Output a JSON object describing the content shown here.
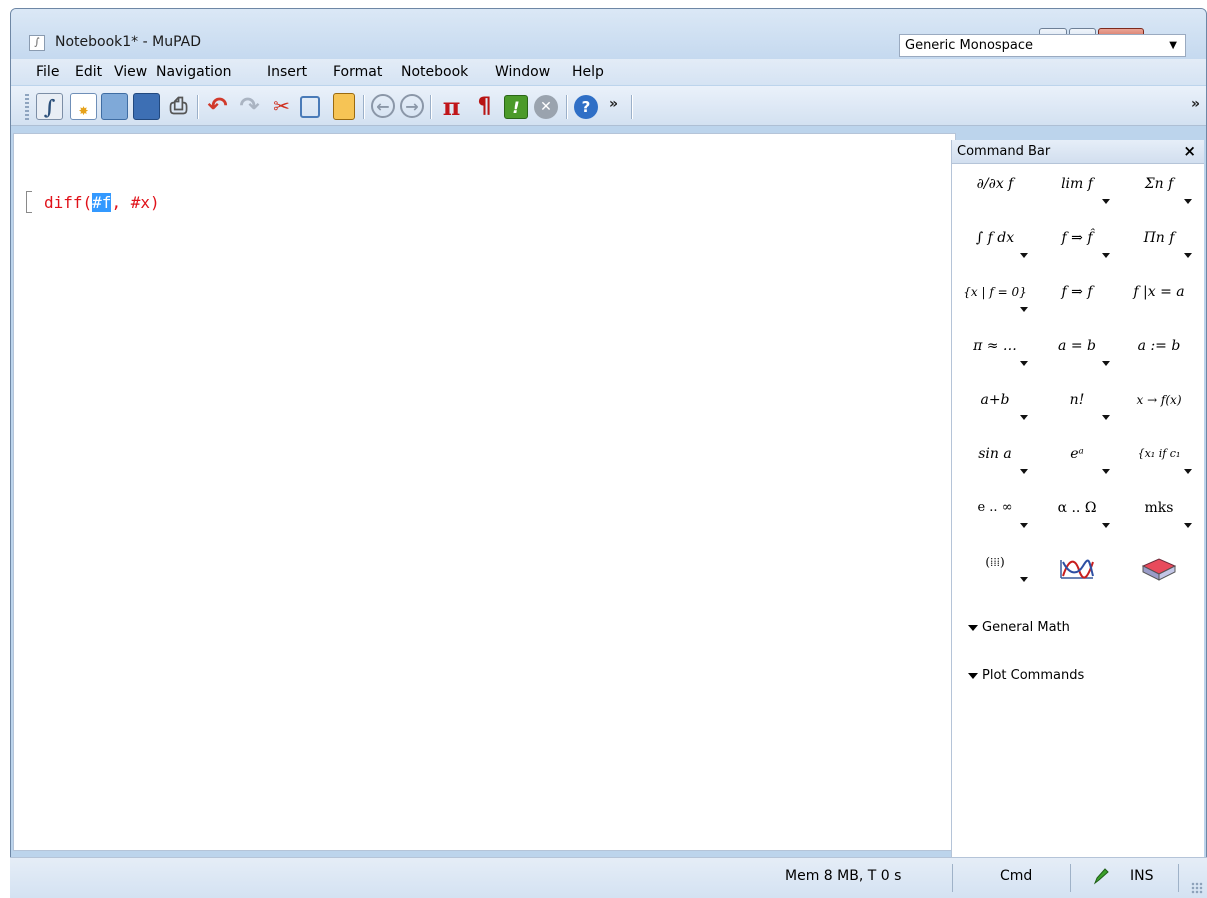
{
  "window": {
    "title": "Notebook1* - MuPAD"
  },
  "menu": [
    "File",
    "Edit",
    "View",
    "Navigation",
    "Insert",
    "Format",
    "Notebook",
    "Window",
    "Help"
  ],
  "toolbar": {
    "buttons": [
      "new-notebook-icon",
      "new-editor-icon",
      "open-icon",
      "save-icon",
      "print-icon",
      "undo-icon",
      "redo-icon",
      "cut-icon",
      "copy-icon",
      "paste-icon",
      "back-icon",
      "forward-icon",
      "insert-calculation-icon",
      "insert-text-icon",
      "evaluate-icon",
      "stop-icon",
      "help-icon"
    ],
    "overflow_label": "»",
    "font_select": "Generic Monospace",
    "overflow2_label": "»"
  },
  "document": {
    "input_prefix": "diff(",
    "input_selected": "#f",
    "input_suffix": ", #x)"
  },
  "command_bar": {
    "title": "Command Bar",
    "close_label": "×",
    "buttons": [
      "∂/∂x f",
      "lim f",
      "Σn f",
      "∫ f dx",
      "f ⇒ f̂",
      "Πn f",
      "{x | f = 0}",
      "f ⇒ f",
      "f |x = a",
      "π ≈ …",
      "a = b",
      "a := b",
      "a+b",
      "n!",
      "x → f(x)",
      "sin a",
      "eᵃ",
      "{x₁ if c₁",
      "e .. ∞",
      "α .. Ω",
      "mks",
      "(⁞⁞⁞)",
      "",
      ""
    ],
    "sections": [
      "General Math",
      "Plot Commands"
    ]
  },
  "status": {
    "memory": "Mem 8 MB, T 0 s",
    "mode": "Cmd",
    "insert": "INS"
  }
}
